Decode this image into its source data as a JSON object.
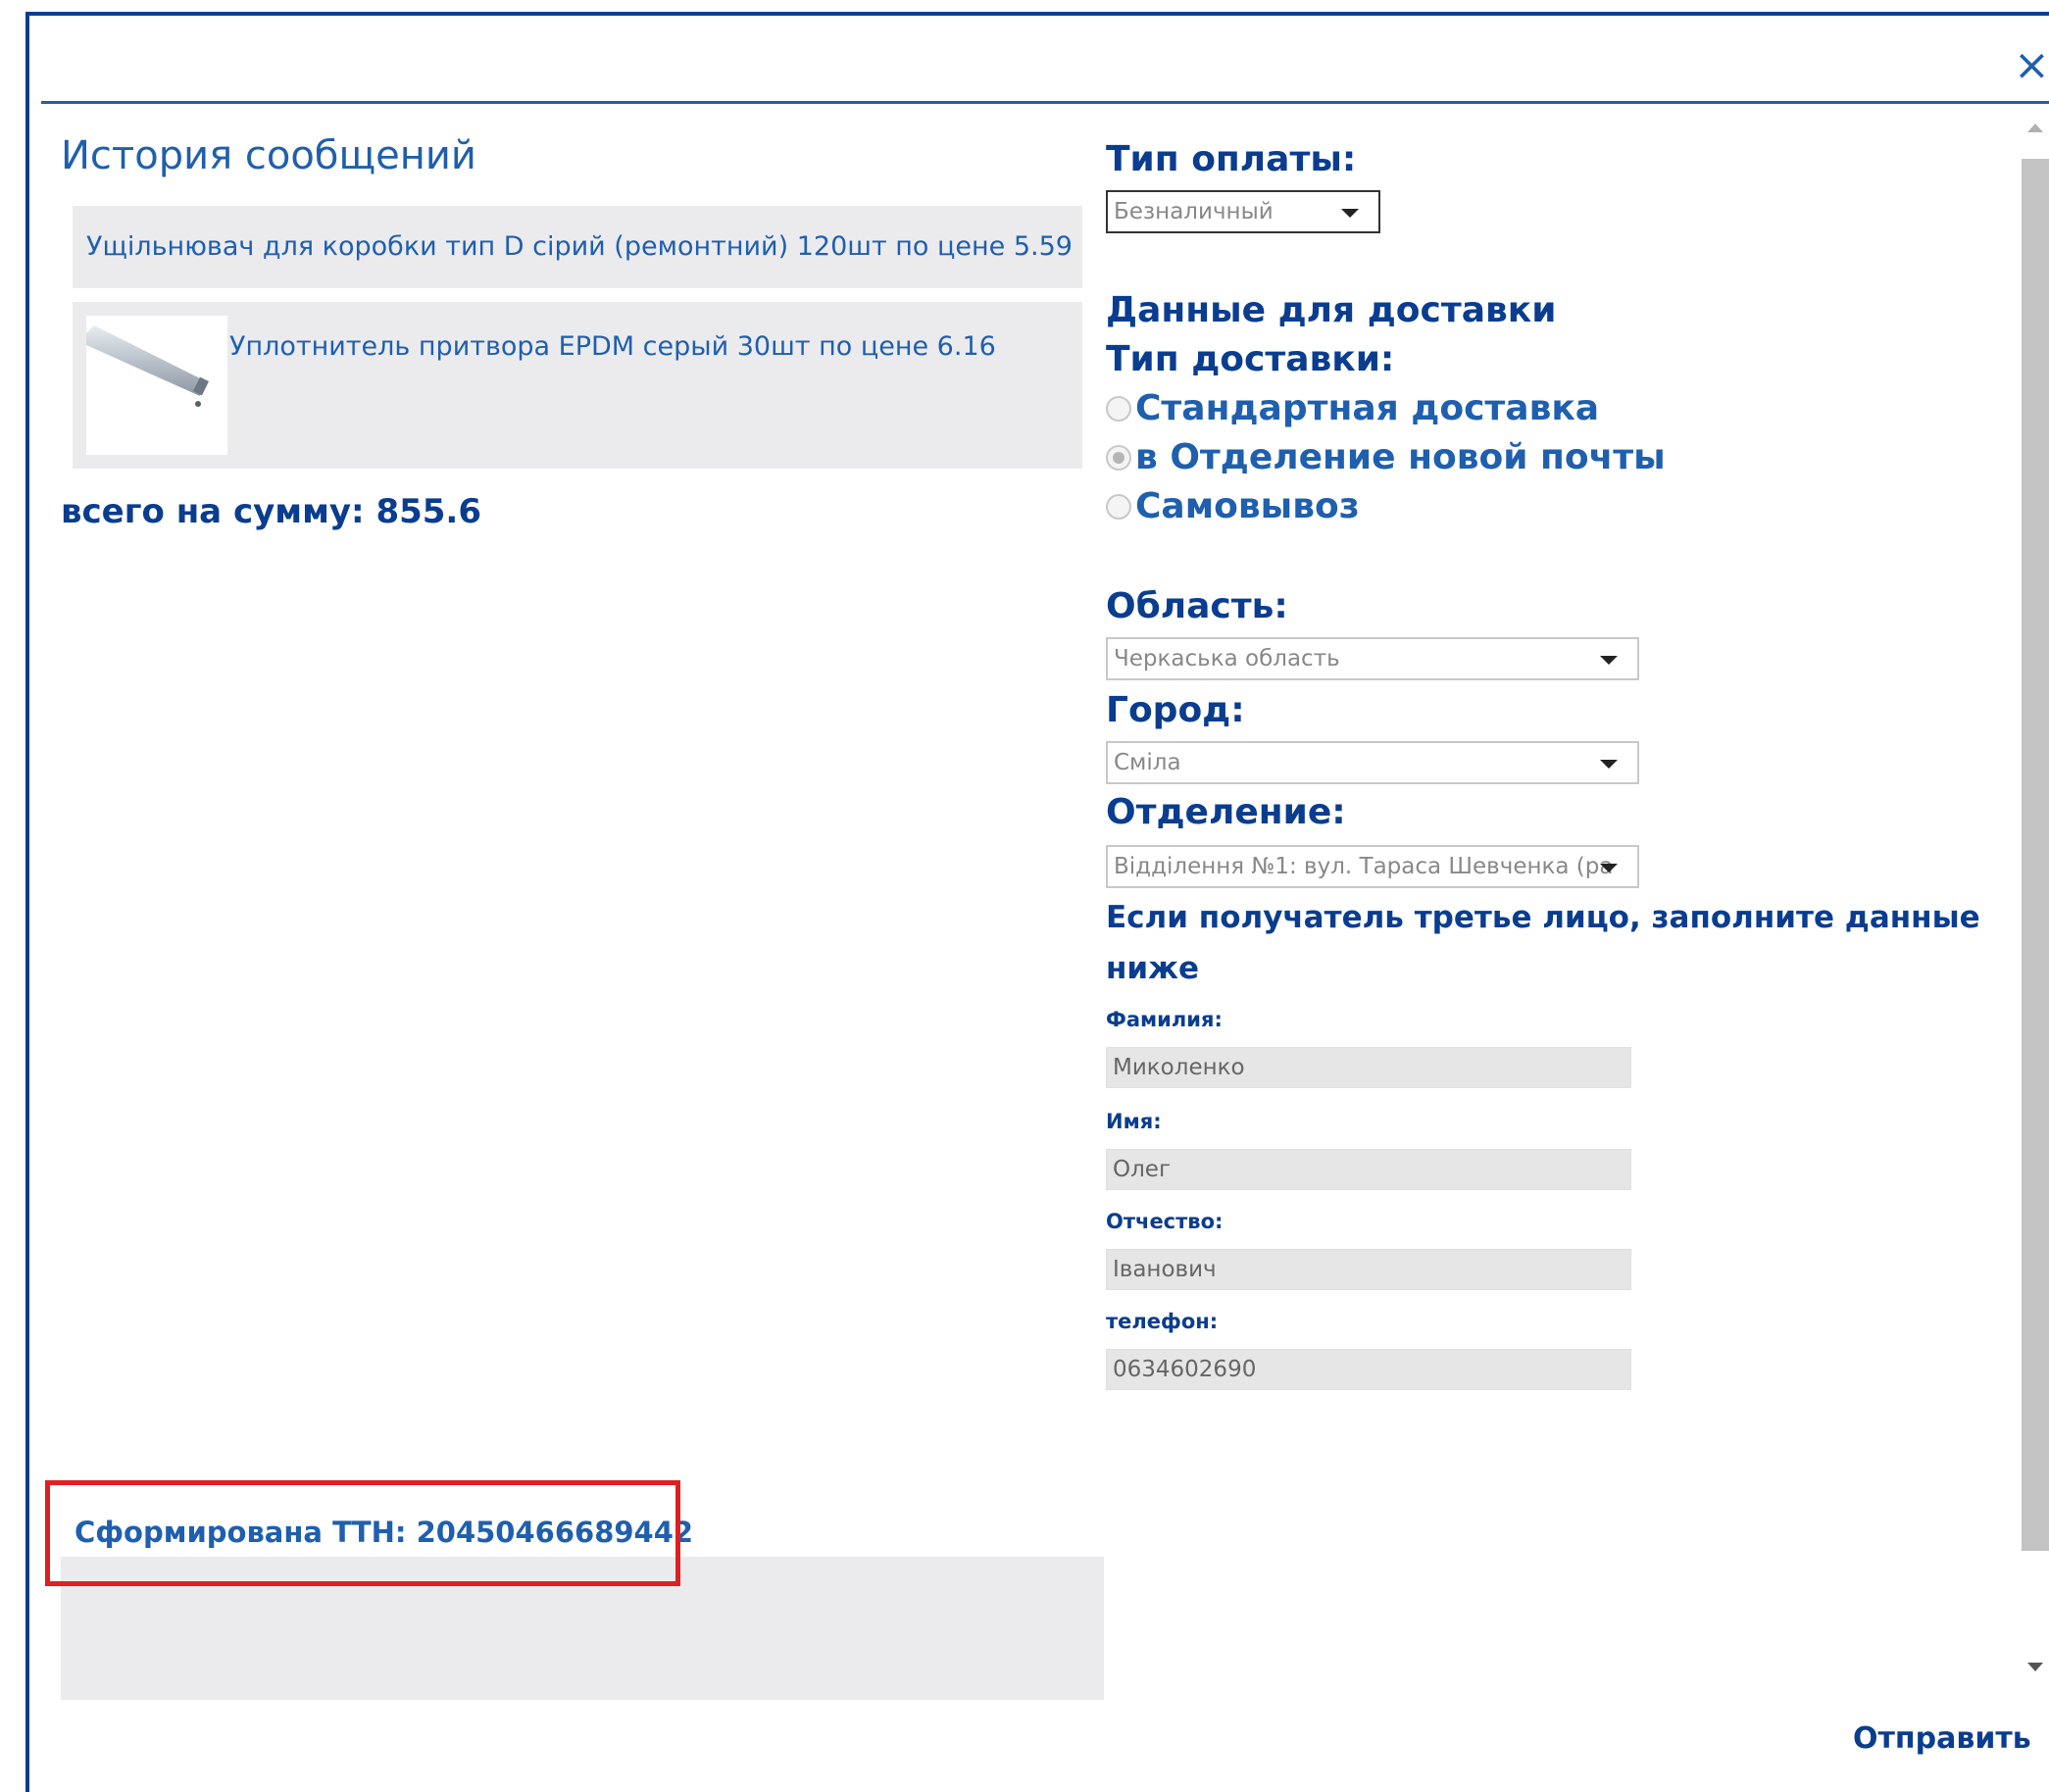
{
  "modal": {
    "close_glyph": "×",
    "history_title": "История сообщений",
    "messages": [
      {
        "text": "Ущільнювач для коробки тип D сірий (ремонтний) 120шт по цене 5.59"
      },
      {
        "text": "Уплотнитель притвора EPDM серый 30шт по цене 6.16",
        "thumbnail": "seal-profile-image"
      }
    ],
    "total": "всего на сумму: 855.6",
    "ttn": "Сформирована ТТН: 20450466689442",
    "reply_value": "",
    "send_label": "Отправить"
  },
  "form": {
    "payment_label": "Тип оплаты:",
    "payment_value": "Безналичный",
    "delivery_data_title": "Данные для доставки",
    "delivery_type_label": "Тип доставки:",
    "delivery_options": [
      {
        "label": "Стандартная доставка",
        "checked": false
      },
      {
        "label": "в Отделение новой почты",
        "checked": true
      },
      {
        "label": "Самовывоз",
        "checked": false
      }
    ],
    "region_label": "Область:",
    "region_value": "Черкаська область",
    "city_label": "Город:",
    "city_value": "Сміла",
    "branch_label": "Отделение:",
    "branch_value": "Відділення №1: вул. Тараса Шевченка (ра",
    "third_party_note_line1": "Если получатель третье лицо, заполните данные",
    "third_party_note_line2": "ниже",
    "surname_label": "Фамилия:",
    "surname_value": "Миколенко",
    "name_label": "Имя:",
    "name_value": "Олег",
    "patronymic_label": "Отчество:",
    "patronymic_value": "Іванович",
    "phone_label": "телефон:",
    "phone_value": "0634602690"
  },
  "colors": {
    "accent": "#1f5fae",
    "dark_blue": "#0a3d8f",
    "highlight_border": "#e02020",
    "message_bg": "#ebebee"
  }
}
